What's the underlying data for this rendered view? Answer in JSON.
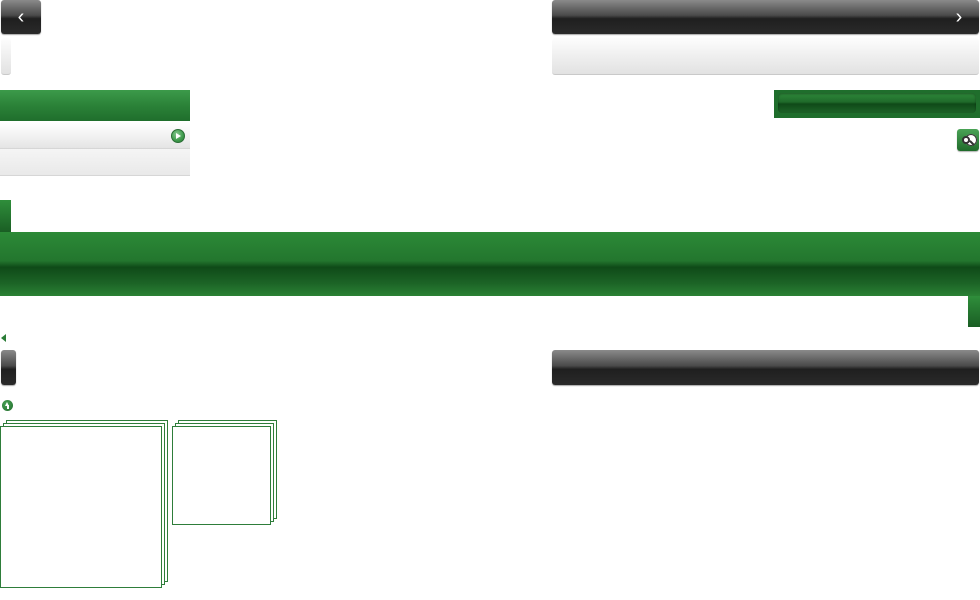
{
  "top_nav": {
    "prev_label": "‹",
    "next_label": "›"
  },
  "icons": {
    "prev": "chevron-left-icon",
    "next": "chevron-right-icon",
    "search": "search-icon",
    "menu_arrow": "play-arrow-icon",
    "back": "back-triangle-icon",
    "up": "up-arrow-icon"
  },
  "colors": {
    "accent_green": "#2b8238",
    "dark_green": "#0f4a18",
    "dark_bar": "#2a2a2a",
    "card_border": "#2e7d3a"
  }
}
